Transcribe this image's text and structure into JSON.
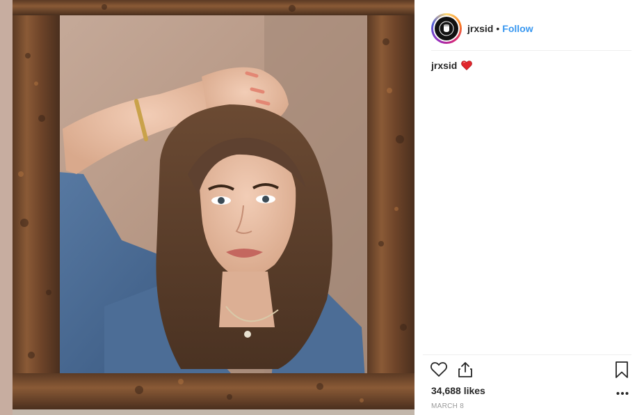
{
  "post": {
    "author": {
      "username": "jrxsid",
      "separator": "•",
      "follow_label": "Follow"
    },
    "caption": {
      "username": "jrxsid",
      "emoji": "red-heart"
    },
    "actions": {
      "like_icon": "heart-icon",
      "share_icon": "share-icon",
      "save_icon": "bookmark-icon",
      "more_icon": "more-options-icon"
    },
    "likes_text": "34,688 likes",
    "date_text": "MARCH 8",
    "colors": {
      "follow": "#3897f0",
      "text": "#262626",
      "date": "#999999",
      "heart": "#e0262c"
    }
  }
}
